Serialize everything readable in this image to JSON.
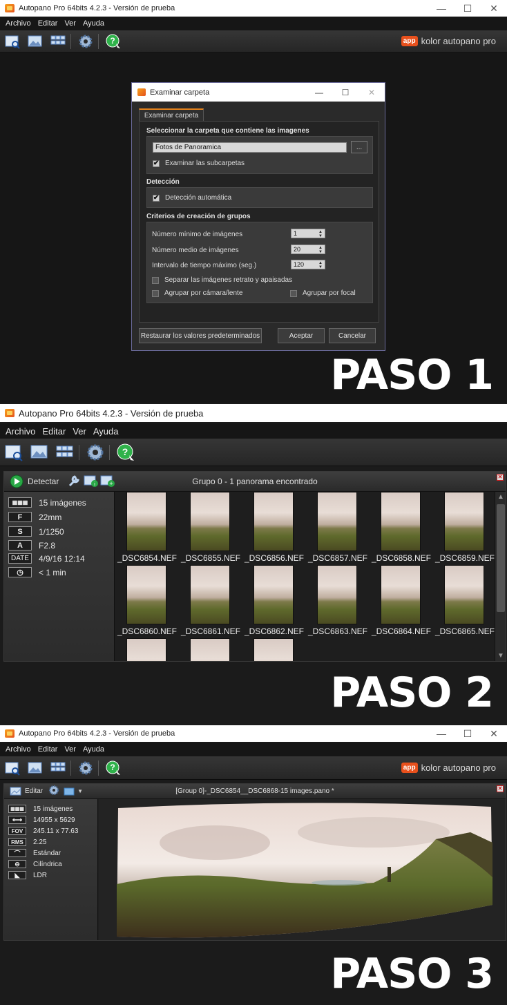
{
  "step1": {
    "window_title": "Autopano Pro 64bits 4.2.3 - Versión de prueba",
    "menu": [
      "Archivo",
      "Editar",
      "Ver",
      "Ayuda"
    ],
    "brand": {
      "badge": "app",
      "text": "kolor autopano pro"
    },
    "dialog": {
      "title": "Examinar carpeta",
      "tab": "Examinar carpeta",
      "folder_section": "Seleccionar la carpeta que contiene las imagenes",
      "folder_value": "Fotos de Panoramica",
      "browse_label": "...",
      "subfolders_label": "Examinar las subcarpetas",
      "subfolders_checked": true,
      "detection_section": "Detección",
      "auto_detect_label": "Detección automática",
      "auto_detect_checked": true,
      "criteria_section": "Criterios de creación de grupos",
      "min_images_label": "Número mínimo de imágenes",
      "min_images_value": "1",
      "avg_images_label": "Número medio de imágenes",
      "avg_images_value": "20",
      "max_interval_label": "Intervalo de tiempo máximo (seg.)",
      "max_interval_value": "120",
      "separate_label": "Separar las imágenes retrato y apaisadas",
      "by_camera_label": "Agrupar por cámara/lente",
      "by_focal_label": "Agrupar por focal",
      "restore_button": "Restaurar los valores predeterminados",
      "accept_button": "Aceptar",
      "cancel_button": "Cancelar"
    },
    "paso": "PASO 1"
  },
  "step2": {
    "window_title": "Autopano Pro 64bits 4.2.3 - Versión de prueba",
    "menu": [
      "Archivo",
      "Editar",
      "Ver",
      "Ayuda"
    ],
    "detect_label": "Detectar",
    "group_title": "Grupo 0 - 1 panorama encontrado",
    "info": [
      {
        "badge": "▦▦▦",
        "value": "15 imágenes"
      },
      {
        "badge": "F",
        "value": "22mm"
      },
      {
        "badge": "S",
        "value": "1/1250"
      },
      {
        "badge": "A",
        "value": "F2.8"
      },
      {
        "badge": "DATE",
        "value": "4/9/16 12:14"
      },
      {
        "badge": "◷",
        "value": "< 1 min"
      }
    ],
    "thumbnails": [
      "_DSC6854.NEF",
      "_DSC6855.NEF",
      "_DSC6856.NEF",
      "_DSC6857.NEF",
      "_DSC6858.NEF",
      "_DSC6859.NEF",
      "_DSC6860.NEF",
      "_DSC6861.NEF",
      "_DSC6862.NEF",
      "_DSC6863.NEF",
      "_DSC6864.NEF",
      "_DSC6865.NEF"
    ],
    "paso": "PASO 2"
  },
  "step3": {
    "window_title": "Autopano Pro 64bits 4.2.3 - Versión de prueba",
    "menu": [
      "Archivo",
      "Editar",
      "Ver",
      "Ayuda"
    ],
    "brand": {
      "badge": "app",
      "text": "kolor autopano pro"
    },
    "edit_label": "Editar",
    "pano_title": "[Group 0]-_DSC6854__DSC6868-15 images.pano *",
    "info": [
      {
        "badge": "▦▦▦",
        "value": "15 imágenes"
      },
      {
        "badge": "⟷",
        "value": "14955 x 5629"
      },
      {
        "badge": "FOV",
        "value": "245.11 x 77.63"
      },
      {
        "badge": "RMS",
        "value": "2.25"
      },
      {
        "badge": "⌒",
        "value": "Estándar"
      },
      {
        "badge": "⊖",
        "value": "Cilíndrica"
      },
      {
        "badge": "◣",
        "value": "LDR"
      }
    ],
    "paso": "PASO 3"
  }
}
